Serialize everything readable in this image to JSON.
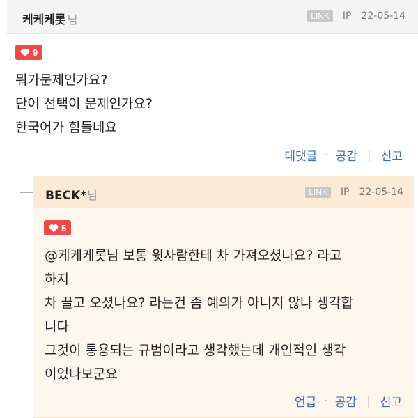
{
  "comment": {
    "author": "케케케롯",
    "author_suffix": "님",
    "link_label": "LINK",
    "ip_label": "IP",
    "date": "22-05-14",
    "likes": "9",
    "lines": [
      "뭐가문제인가요?",
      "단어 선택이 문제인가요?",
      "한국어가 힘들네요"
    ],
    "actions": {
      "reply": "대댓글",
      "like": "공감",
      "report": "신고"
    }
  },
  "reply": {
    "author": "BECK*",
    "author_suffix": "님",
    "link_label": "LINK",
    "ip_label": "IP",
    "date": "22-05-14",
    "likes": "5",
    "lines": [
      "@케케케롯님 보통 윗사람한테 차 가져오셨나요? 라고",
      "하지",
      "차 끌고 오셨나요? 라는건 좀 예의가 아니지 않나 생각합",
      "니다",
      "그것이 통용되는 규범이라고 생각했는데 개인적인 생각",
      "이었나보군요"
    ],
    "actions": {
      "mention": "언급",
      "like": "공감",
      "report": "신고"
    }
  },
  "colors": {
    "like_badge": "#ef4848",
    "action_link": "#3d6fb5",
    "reply_bg": "#fdf7ee",
    "reply_header_bg": "#fbead4"
  }
}
